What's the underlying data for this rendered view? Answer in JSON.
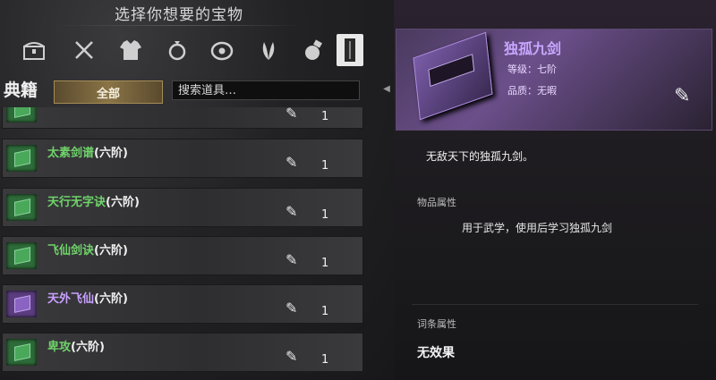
{
  "header": {
    "title": "选择你想要的宝物"
  },
  "categories": [
    {
      "icon": "chest-icon"
    },
    {
      "icon": "crossed-weapons-icon"
    },
    {
      "icon": "armor-icon"
    },
    {
      "icon": "ring-icon"
    },
    {
      "icon": "amulet-icon"
    },
    {
      "icon": "herb-icon"
    },
    {
      "icon": "potion-icon"
    },
    {
      "icon": "book-icon"
    }
  ],
  "tabs": {
    "title": "典籍",
    "all_label": "全部"
  },
  "search": {
    "placeholder": "搜索道具…"
  },
  "list": {
    "items": [
      {
        "name": "",
        "tier": "",
        "quantity": "1",
        "quality": "green"
      },
      {
        "name": "太素剑谱",
        "tier": "(六阶)",
        "quantity": "1",
        "quality": "green"
      },
      {
        "name": "天行无字诀",
        "tier": "(六阶)",
        "quantity": "1",
        "quality": "green"
      },
      {
        "name": "飞仙剑诀",
        "tier": "(六阶)",
        "quantity": "1",
        "quality": "green"
      },
      {
        "name": "天外飞仙",
        "tier": "(六阶)",
        "quantity": "1",
        "quality": "purple"
      },
      {
        "name": "卑攻",
        "tier": "(六阶)",
        "quantity": "1",
        "quality": "green"
      }
    ]
  },
  "detail": {
    "title": "独孤九剑",
    "grade": "等级：七阶",
    "quality": "品质：无暇",
    "description": "无敌天下的独孤九剑。",
    "item_attr_label": "物品属性",
    "effect": "用于武学，使用后学习独孤九剑",
    "entry_attr_label": "词条属性",
    "entry_effect": "无效果"
  },
  "colors": {
    "green": "#6fd36a",
    "purple": "#c8a0ff",
    "accent": "#8a7446"
  }
}
